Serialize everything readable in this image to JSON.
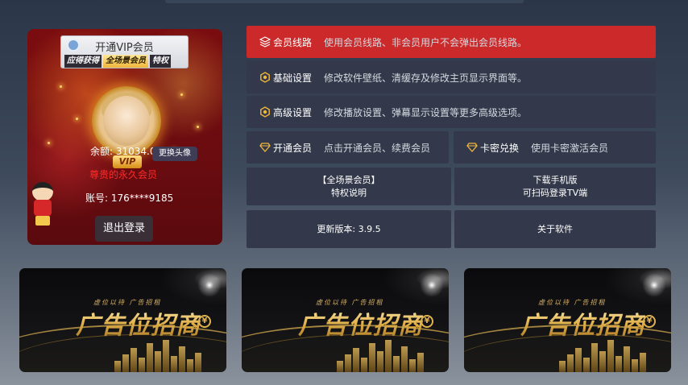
{
  "profile": {
    "vip_banner_title": "开通VIP会员",
    "vip_banner_tags": [
      "应得获得",
      "全场景会员",
      "特权"
    ],
    "vip_badge": "VIP",
    "balance": "余额: 31034.06",
    "change_avatar": "更换头像",
    "member_status": "尊贵的永久会员",
    "account": "账号: 176****9185",
    "logout": "退出登录"
  },
  "menu": [
    {
      "label": "会员线路",
      "desc": "使用会员线路、非会员用户不会弹出会员线路。",
      "icon": "layers-icon",
      "active": true
    },
    {
      "label": "基础设置",
      "desc": "修改软件壁纸、清缓存及修改主页显示界面等。",
      "icon": "gear-icon",
      "active": false
    },
    {
      "label": "高级设置",
      "desc": "修改播放设置、弹幕显示设置等更多高级选项。",
      "icon": "gear-icon",
      "active": false
    }
  ],
  "half_menu": [
    {
      "label": "开通会员",
      "desc": "点击开通会员、续费会员",
      "icon": "diamond-icon"
    },
    {
      "label": "卡密兑换",
      "desc": "使用卡密激活会员",
      "icon": "diamond-icon"
    }
  ],
  "tiles": {
    "full_member_line1": "【全场景会员】",
    "full_member_line2": "特权说明",
    "download_line1": "下载手机版",
    "download_line2": "可扫码登录TV端",
    "update_version": "更新版本: 3.9.5",
    "about": "关于软件"
  },
  "ads": [
    {
      "sub": "虚位以待 广告招租",
      "big": "广告位招商",
      "coin": "¥"
    },
    {
      "sub": "虚位以待 广告招租",
      "big": "广告位招商",
      "coin": "¥"
    },
    {
      "sub": "虚位以待 广告招租",
      "big": "广告位招商",
      "coin": "¥"
    }
  ],
  "colors": {
    "accent": "#cc2a2a",
    "tile": "#33394a",
    "gold": "#e0b250"
  }
}
